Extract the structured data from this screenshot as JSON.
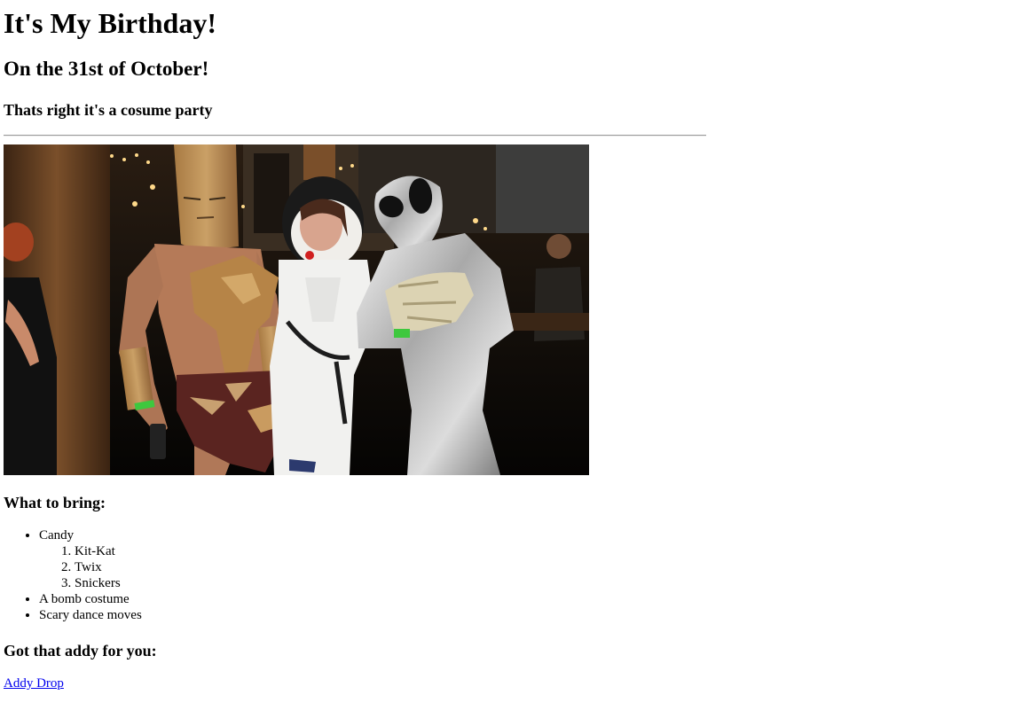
{
  "header": {
    "title": "It's My Birthday!",
    "date_line": "On the 31st of October!",
    "tagline": "Thats right it's a cosume party"
  },
  "photo": {
    "description_icon": "costume-party-photo"
  },
  "bring": {
    "heading": "What to bring:",
    "items": [
      {
        "label": "Candy",
        "sub_items": [
          "Kit-Kat",
          "Twix",
          "Snickers"
        ]
      },
      {
        "label": "A bomb costume"
      },
      {
        "label": "Scary dance moves"
      }
    ]
  },
  "address": {
    "heading": "Got that addy for you:",
    "link_label": "Addy Drop"
  },
  "colors": {
    "link": "#0000ee",
    "text": "#000000",
    "background": "#ffffff"
  }
}
